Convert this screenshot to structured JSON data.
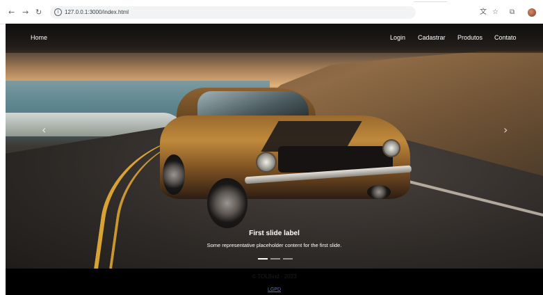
{
  "browser": {
    "url": "127.0.0.1:3000/index.html",
    "back_icon": "arrow-left-icon",
    "forward_icon": "arrow-right-icon",
    "reload_icon": "reload-icon"
  },
  "navbar": {
    "brand": "Home",
    "links": [
      "Login",
      "Cadastrar",
      "Produtos",
      "Contato"
    ]
  },
  "carousel": {
    "slide_title": "First slide label",
    "slide_text": "Some representative placeholder content for the first slide.",
    "indicators": 3,
    "active_index": 0,
    "prev_icon": "chevron-left-icon",
    "next_icon": "chevron-right-icon"
  },
  "footer": {
    "copyright": "© TOLBind - 2023",
    "lgpd_link": "LGPD"
  },
  "colors": {
    "navbar_bg": "#000000",
    "footer_bg": "#000000",
    "link": "#4f6fff"
  }
}
